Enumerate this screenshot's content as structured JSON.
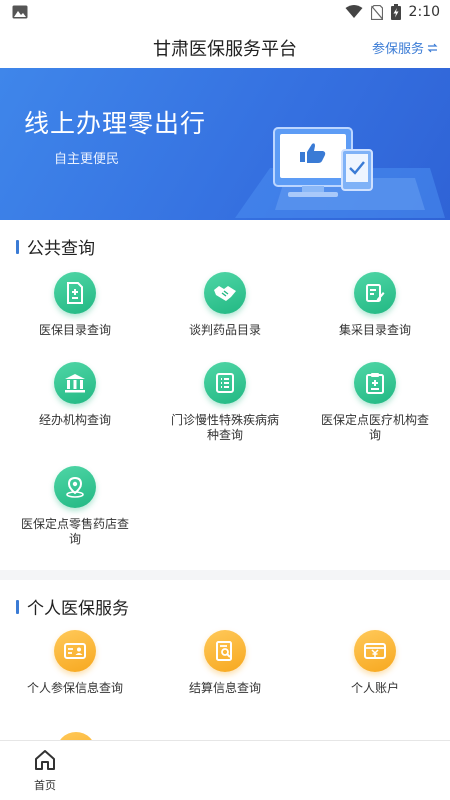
{
  "status_bar": {
    "time": "2:10"
  },
  "header": {
    "title": "甘肃医保服务平台",
    "action_label": "参保服务"
  },
  "banner": {
    "title": "线上办理零出行",
    "subtitle": "自主更便民"
  },
  "public_section": {
    "title": "公共查询",
    "items": [
      {
        "label": "医保目录查询",
        "icon": "document-plus-icon"
      },
      {
        "label": "谈判药品目录",
        "icon": "handshake-icon"
      },
      {
        "label": "集采目录查询",
        "icon": "edit-document-icon"
      },
      {
        "label": "经办机构查询",
        "icon": "institution-icon"
      },
      {
        "label": "门诊慢性特殊疾病病种查询",
        "icon": "list-icon"
      },
      {
        "label": "医保定点医疗机构查询",
        "icon": "medical-clipboard-icon"
      },
      {
        "label": "医保定点零售药店查询",
        "icon": "location-pin-icon"
      }
    ]
  },
  "personal_section": {
    "title": "个人医保服务",
    "items": [
      {
        "label": "个人参保信息查询",
        "icon": "person-card-icon"
      },
      {
        "label": "结算信息查询",
        "icon": "document-search-icon"
      },
      {
        "label": "个人账户",
        "icon": "wallet-yuan-icon"
      }
    ]
  },
  "bottom_nav": {
    "home_label": "首页"
  },
  "colors": {
    "accent": "#3a7bd5",
    "green": "#22b883",
    "orange": "#f7a81f",
    "banner": "#3570e0"
  }
}
